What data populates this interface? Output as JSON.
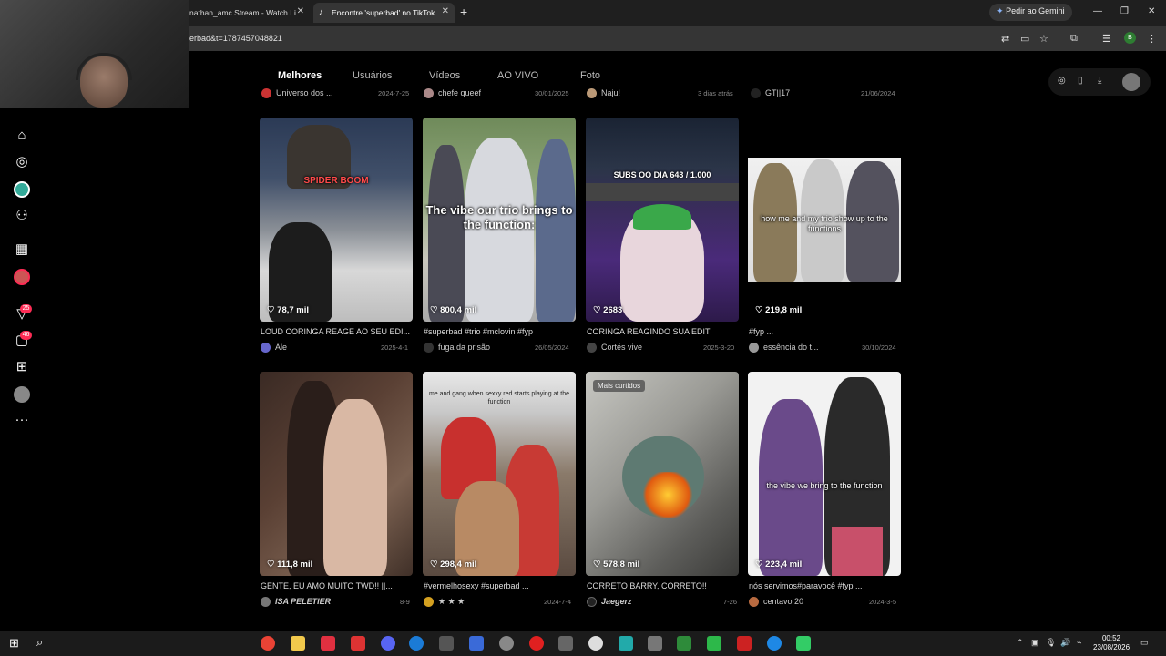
{
  "browser": {
    "tabs": [
      {
        "label": "nathan_amc Stream - Watch Li"
      },
      {
        "label": "Encontre 'superbad' no TikTok"
      }
    ],
    "gemini_label": "Pedir ao Gemini",
    "url": "erbad&t=1787457048821",
    "profile_initial": "B"
  },
  "nav": {
    "tabs": [
      "Melhores",
      "Usuários",
      "Vídeos",
      "AO VIVO",
      "Foto"
    ]
  },
  "sidebar": {
    "badges": {
      "activity": "25",
      "messages": "46"
    }
  },
  "prev_row": [
    {
      "name": "Universo dos ...",
      "date": "2024-7-25"
    },
    {
      "name": "chefe queef",
      "date": "30/01/2025"
    },
    {
      "name": "Naju!",
      "date": "3 dias atrás"
    },
    {
      "name": "GT||17",
      "date": "21/06/2024"
    }
  ],
  "cards": [
    {
      "likes": "78,7 mil",
      "caption": "LOUD CORINGA REAGE AO SEU EDI...",
      "author": "Ale",
      "date": "2025-4-1",
      "overlay": "SPIDER BOOM"
    },
    {
      "likes": "800,4 mil",
      "caption": "#superbad #trio #mclovin #fyp",
      "author": "fuga da prisão",
      "date": "26/05/2024",
      "overlay": "The vibe our trio brings to the function:"
    },
    {
      "likes": "2683",
      "caption": "CORINGA REAGINDO SUA EDIT",
      "author": "Cortés vive",
      "date": "2025-3-20",
      "overlay": "SUBS OO DIA 643 / 1.000"
    },
    {
      "likes": "219,8 mil",
      "caption": "#fyp ...",
      "author": "essência do t...",
      "date": "30/10/2024",
      "overlay": "how me and my trio show up to the functions"
    },
    {
      "likes": "111,8 mil",
      "caption": "GENTE, EU AMO MUITO TWD!! ||...",
      "author": "ISA PELETIER",
      "date": "8-9",
      "overlay": ""
    },
    {
      "likes": "298,4 mil",
      "caption": "#vermelhosexy #superbad ...",
      "author": "★ ★ ★",
      "date": "2024-7-4",
      "overlay": "me and gang when sexxy red starts playing at the function"
    },
    {
      "likes": "578,8 mil",
      "caption": "CORRETO BARRY, CORRETO!!",
      "author": "Jaegerz",
      "date": "7-26",
      "overlay": "",
      "badge": "Mais curtidos"
    },
    {
      "likes": "223,4 mil",
      "caption": "nós servimos#paravocê #fyp ...",
      "author": "centavo 20",
      "date": "2024-3-5",
      "overlay": "the vibe we bring to the function"
    }
  ],
  "taskbar": {
    "time": "00:52",
    "date": "23/08/2026"
  }
}
